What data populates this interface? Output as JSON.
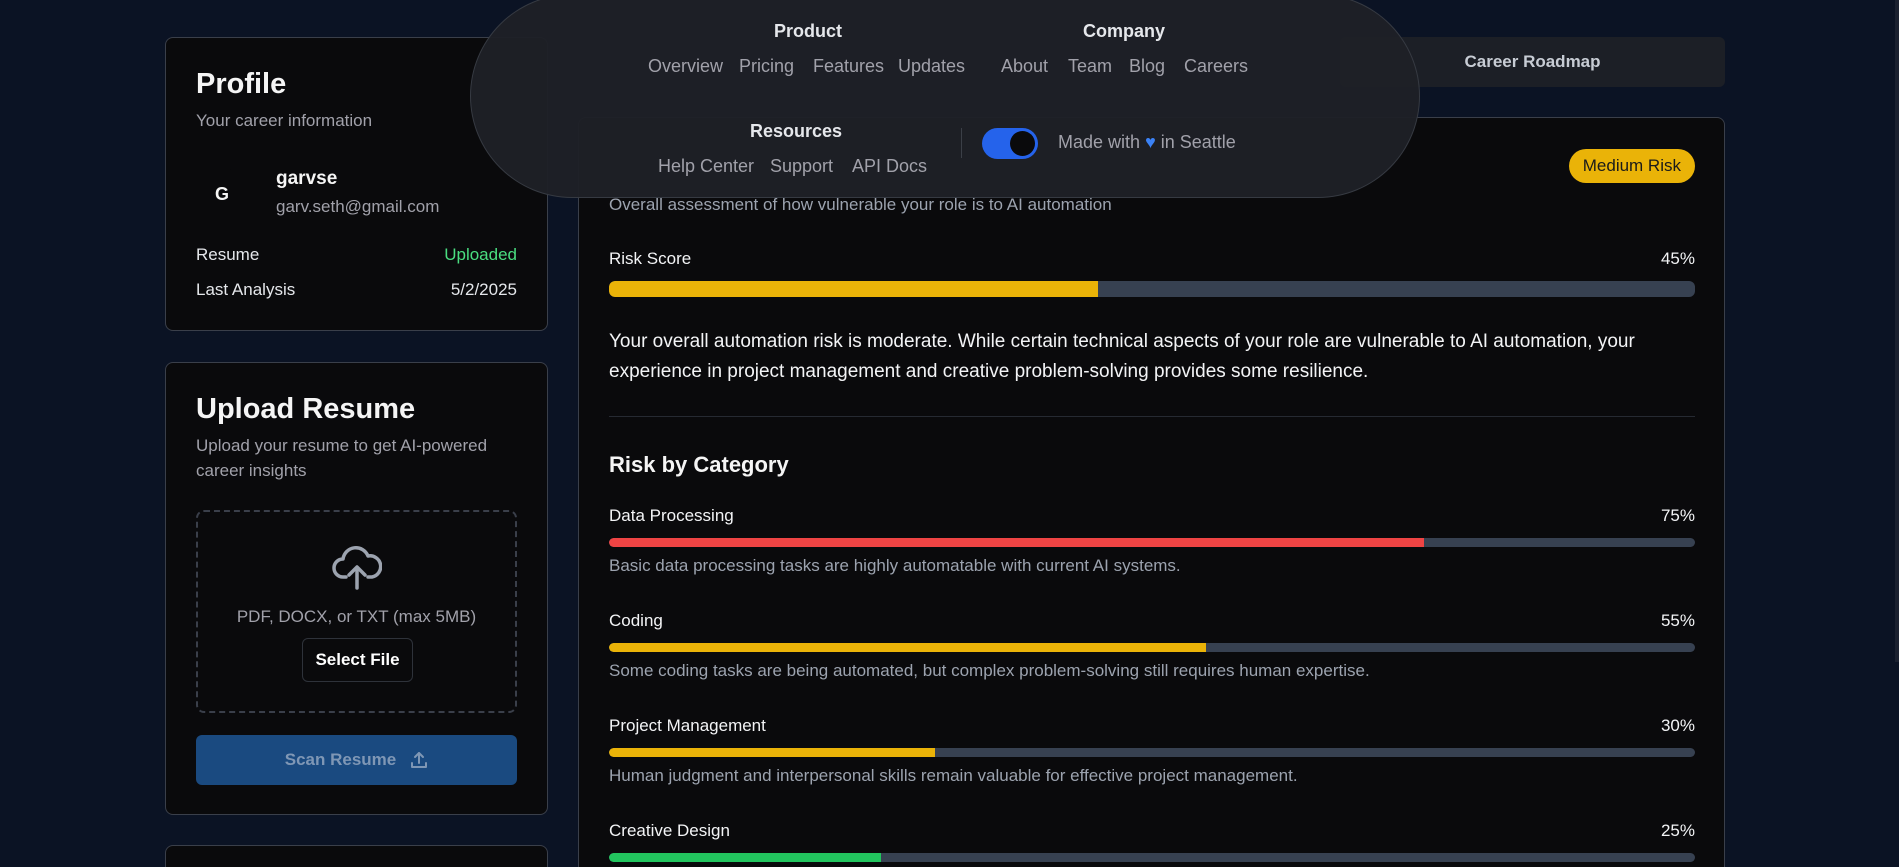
{
  "nav": {
    "product": {
      "heading": "Product",
      "links": [
        "Overview",
        "Pricing",
        "Features",
        "Updates"
      ]
    },
    "company": {
      "heading": "Company",
      "links": [
        "About",
        "Team",
        "Blog",
        "Careers"
      ]
    },
    "resources": {
      "heading": "Resources",
      "links": [
        "Help Center",
        "Support",
        "API Docs"
      ]
    },
    "made_with_prefix": "Made with",
    "made_with_heart": "♥",
    "made_with_suffix": "in Seattle",
    "toggle_on": true
  },
  "profile": {
    "title": "Profile",
    "subtitle": "Your career information",
    "avatar_initial": "G",
    "username": "garvse",
    "email": "garv.seth@gmail.com",
    "resume_label": "Resume",
    "resume_status": "Uploaded",
    "last_analysis_label": "Last Analysis",
    "last_analysis_date": "5/2/2025"
  },
  "upload": {
    "title": "Upload Resume",
    "subtitle": "Upload your resume to get AI-powered career insights",
    "formats": "PDF, DOCX, or TXT (max 5MB)",
    "select_label": "Select File",
    "scan_label": "Scan Resume"
  },
  "tabs": {
    "career_roadmap": "Career Roadmap"
  },
  "risk": {
    "badge": "Medium Risk",
    "assessment": "Overall assessment of how vulnerable your role is to AI automation",
    "score_label": "Risk Score",
    "score_text": "45%",
    "score_value": 45,
    "summary": "Your overall automation risk is moderate. While certain technical aspects of your role are vulnerable to AI automation, your experience in project management and creative problem-solving provides some resilience.",
    "category_title": "Risk by Category",
    "categories": [
      {
        "name": "Data Processing",
        "percent_text": "75%",
        "value": 75,
        "color": "#ef4444",
        "desc": "Basic data processing tasks are highly automatable with current AI systems."
      },
      {
        "name": "Coding",
        "percent_text": "55%",
        "value": 55,
        "color": "#eab308",
        "desc": "Some coding tasks are being automated, but complex problem-solving still requires human expertise."
      },
      {
        "name": "Project Management",
        "percent_text": "30%",
        "value": 30,
        "color": "#eab308",
        "desc": "Human judgment and interpersonal skills remain valuable for effective project management."
      },
      {
        "name": "Creative Design",
        "percent_text": "25%",
        "value": 25,
        "color": "#22c55e",
        "desc": ""
      }
    ]
  },
  "colors": {
    "background": "#0b1324",
    "accent_blue": "#2563eb",
    "success_green": "#4ade80",
    "warning_yellow": "#eab308",
    "danger_red": "#ef4444"
  }
}
